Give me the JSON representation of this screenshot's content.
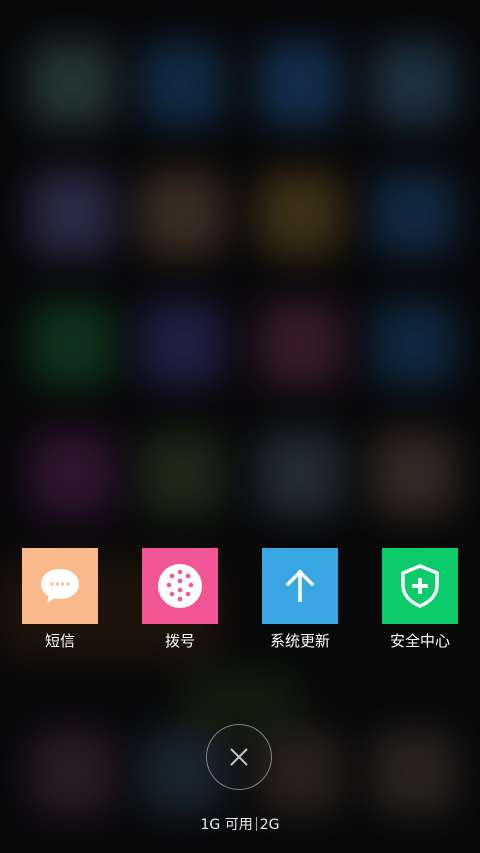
{
  "recent_apps": [
    {
      "label": "短信",
      "icon": "message-icon",
      "color": "#F9B98A"
    },
    {
      "label": "拨号",
      "icon": "dialpad-icon",
      "color": "#F25696"
    },
    {
      "label": "系统更新",
      "icon": "arrow-up-icon",
      "color": "#39A7E4"
    },
    {
      "label": "安全中心",
      "icon": "shield-plus-icon",
      "color": "#0CCB6A"
    }
  ],
  "close_button": {
    "icon": "close-icon"
  },
  "memory": {
    "available": "1G 可用",
    "total": "2G"
  }
}
